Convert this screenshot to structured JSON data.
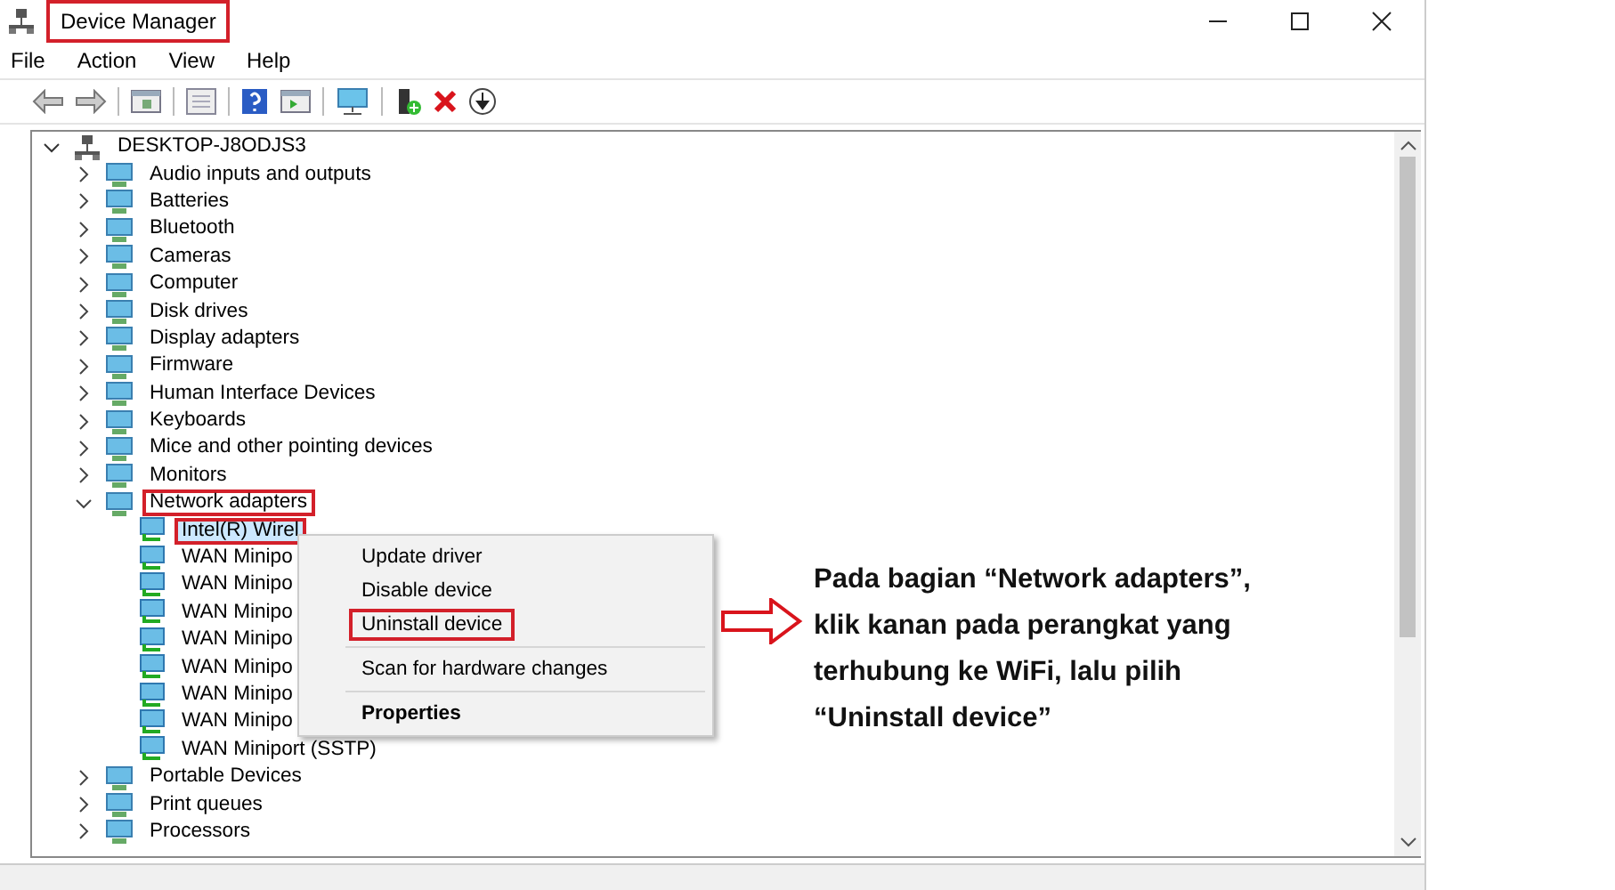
{
  "window": {
    "title": "Device Manager",
    "title_highlighted": true
  },
  "menu": [
    "File",
    "Action",
    "View",
    "Help"
  ],
  "tree": {
    "label": "DESKTOP-J8ODJS3",
    "expanded": true,
    "children": [
      {
        "label": "Audio inputs and outputs",
        "expanded": false,
        "highlighted": false
      },
      {
        "label": "Batteries",
        "expanded": false,
        "highlighted": false
      },
      {
        "label": "Bluetooth",
        "expanded": false,
        "highlighted": false
      },
      {
        "label": "Cameras",
        "expanded": false,
        "highlighted": false
      },
      {
        "label": "Computer",
        "expanded": false,
        "highlighted": false
      },
      {
        "label": "Disk drives",
        "expanded": false,
        "highlighted": false
      },
      {
        "label": "Display adapters",
        "expanded": false,
        "highlighted": false
      },
      {
        "label": "Firmware",
        "expanded": false,
        "highlighted": false
      },
      {
        "label": "Human Interface Devices",
        "expanded": false,
        "highlighted": false
      },
      {
        "label": "Keyboards",
        "expanded": false,
        "highlighted": false
      },
      {
        "label": "Mice and other pointing devices",
        "expanded": false,
        "highlighted": false
      },
      {
        "label": "Monitors",
        "expanded": false,
        "highlighted": false
      },
      {
        "label": "Network adapters",
        "expanded": true,
        "highlighted": true,
        "children": [
          {
            "label": "Intel(R) Wirel",
            "selected": true,
            "highlighted": true
          },
          {
            "label": "WAN Minipo",
            "selected": false,
            "highlighted": false
          },
          {
            "label": "WAN Minipo",
            "selected": false,
            "highlighted": false
          },
          {
            "label": "WAN Minipo",
            "selected": false,
            "highlighted": false
          },
          {
            "label": "WAN Minipo",
            "selected": false,
            "highlighted": false
          },
          {
            "label": "WAN Minipo",
            "selected": false,
            "highlighted": false
          },
          {
            "label": "WAN Minipo",
            "selected": false,
            "highlighted": false
          },
          {
            "label": "WAN Minipo",
            "selected": false,
            "highlighted": false
          },
          {
            "label": "WAN Miniport (SSTP)",
            "selected": false,
            "highlighted": false
          }
        ]
      },
      {
        "label": "Portable Devices",
        "expanded": false,
        "highlighted": false
      },
      {
        "label": "Print queues",
        "expanded": false,
        "highlighted": false
      },
      {
        "label": "Processors",
        "expanded": false,
        "highlighted": false
      }
    ]
  },
  "context_menu": [
    {
      "kind": "item",
      "label": "Update driver",
      "highlighted": false,
      "default": false
    },
    {
      "kind": "item",
      "label": "Disable device",
      "highlighted": false,
      "default": false
    },
    {
      "kind": "item",
      "label": "Uninstall device",
      "highlighted": true,
      "default": false
    },
    {
      "kind": "separator"
    },
    {
      "kind": "item",
      "label": "Scan for hardware changes",
      "highlighted": false,
      "default": false
    },
    {
      "kind": "separator"
    },
    {
      "kind": "item",
      "label": "Properties",
      "highlighted": false,
      "default": true
    }
  ],
  "annotation": {
    "text": "Pada bagian “Network adapters”, klik kanan pada perangkat yang terhubung ke WiFi, lalu pilih “Uninstall device”"
  }
}
